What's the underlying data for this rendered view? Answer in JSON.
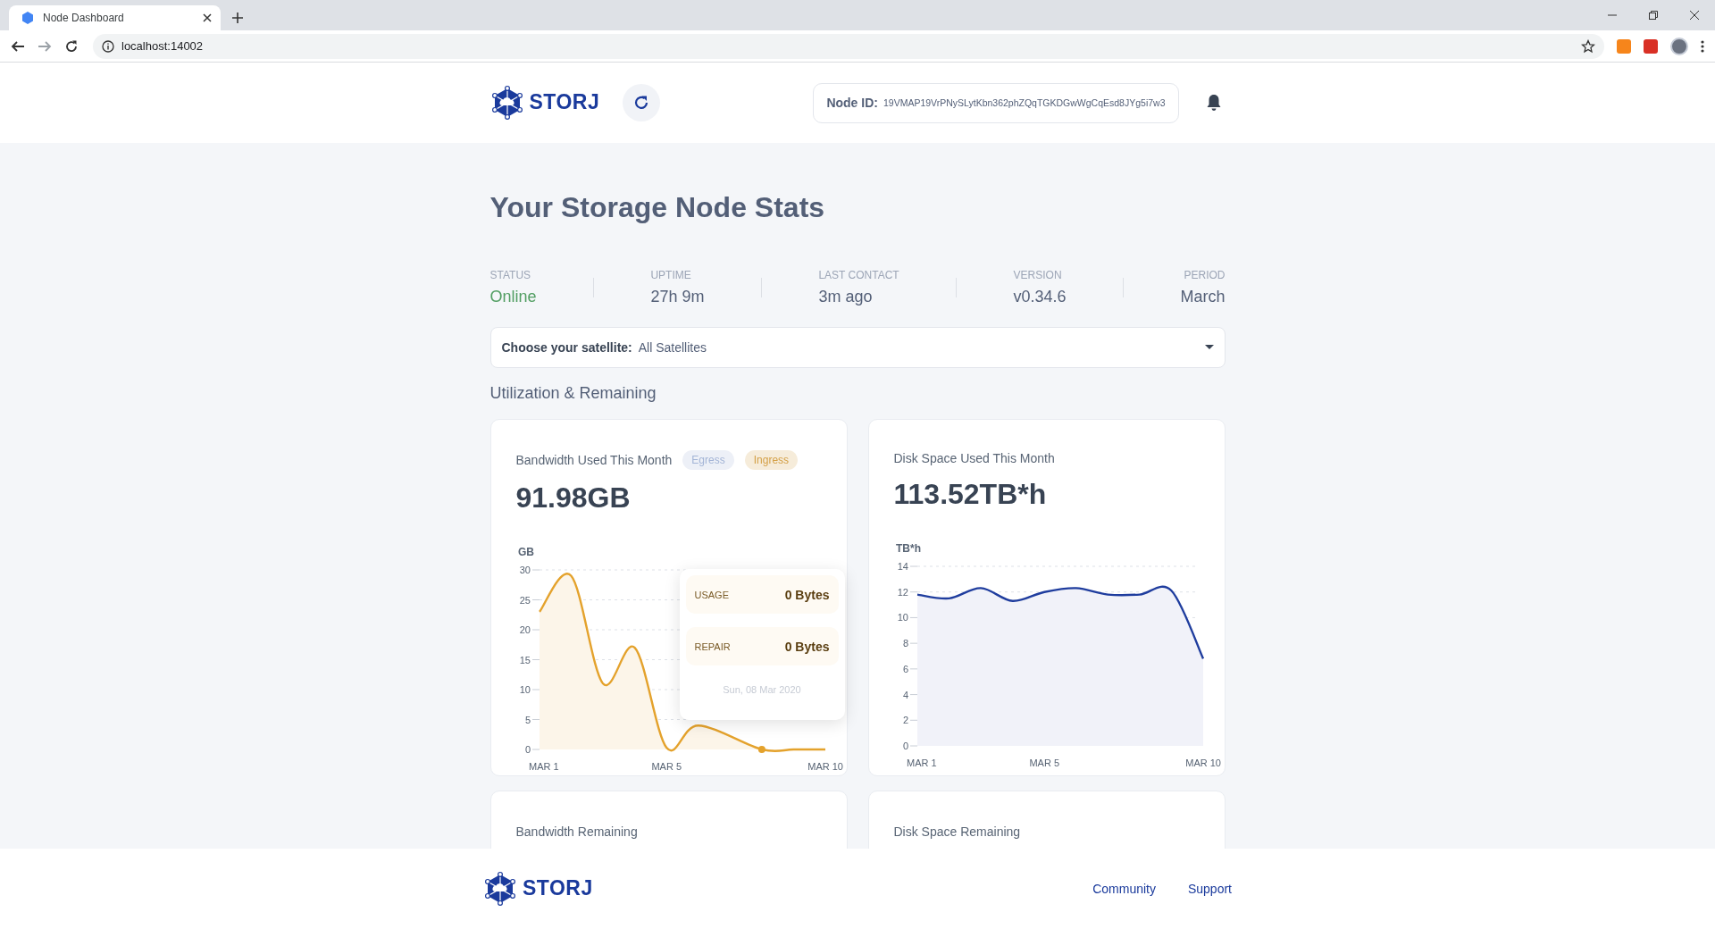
{
  "browser": {
    "tab_title": "Node Dashboard",
    "address": "localhost:14002"
  },
  "header": {
    "logo": "STORJ",
    "node_id_label": "Node ID:",
    "node_id": "19VMAP19VrPNySLytKbn362phZQqTGKDGwWgCqEsd8JYg5i7w3"
  },
  "title": "Your Storage Node Stats",
  "stats": [
    {
      "label": "STATUS",
      "value": "Online",
      "kind": "status"
    },
    {
      "label": "UPTIME",
      "value": "27h 9m",
      "kind": "plain"
    },
    {
      "label": "LAST CONTACT",
      "value": "3m ago",
      "kind": "plain"
    },
    {
      "label": "VERSION",
      "value": "v0.34.6",
      "kind": "plain"
    },
    {
      "label": "PERIOD",
      "value": "March",
      "kind": "plain"
    }
  ],
  "satellite": {
    "label": "Choose your satellite:",
    "value": "All Satellites"
  },
  "section_title": "Utilization & Remaining",
  "cards": [
    {
      "title": "Bandwidth Used This Month",
      "legend": [
        {
          "label": "Egress",
          "color": "#a3b4d6"
        },
        {
          "label": "Ingress",
          "color": "#d4a047"
        }
      ],
      "total": "91.98GB",
      "chart_data": {
        "type": "area",
        "ylabel": "GB",
        "categories": [
          "MAR 1",
          null,
          null,
          null,
          "MAR 5",
          null,
          null,
          null,
          null,
          "MAR 10"
        ],
        "series": [
          {
            "color": "#e4a22c",
            "values": [
              23,
              29,
              11,
              17,
              0.3,
              4,
              null,
              0,
              0,
              0
            ]
          }
        ],
        "ylim": [
          0,
          30
        ],
        "yticks": [
          0,
          5,
          10,
          15,
          20,
          25,
          30
        ],
        "grid": true
      },
      "tooltip": {
        "rows": [
          {
            "label": "USAGE",
            "value": "0 Bytes"
          },
          {
            "label": "REPAIR",
            "value": "0 Bytes"
          }
        ],
        "date": "Sun, 08 Mar 2020"
      }
    },
    {
      "title": "Disk Space Used This Month",
      "total": "113.52TB*h",
      "chart_data": {
        "type": "area",
        "ylabel": "TB*h",
        "categories": [
          "MAR 1",
          null,
          null,
          null,
          "MAR 5",
          null,
          null,
          null,
          null,
          "MAR 10"
        ],
        "series": [
          {
            "color": "#1f3d9e",
            "values": [
              11.8,
              11.5,
              12.3,
              11.3,
              12.0,
              12.3,
              11.8,
              11.8,
              12.1,
              6.8
            ]
          }
        ],
        "ylim": [
          0,
          14
        ],
        "yticks": [
          0,
          2,
          4,
          6,
          8,
          10,
          12,
          14
        ],
        "grid": true
      }
    }
  ],
  "remaining_cards": [
    {
      "title": "Bandwidth Remaining"
    },
    {
      "title": "Disk Space Remaining"
    }
  ],
  "footer": {
    "logo": "STORJ",
    "links": [
      "Community",
      "Support"
    ]
  }
}
